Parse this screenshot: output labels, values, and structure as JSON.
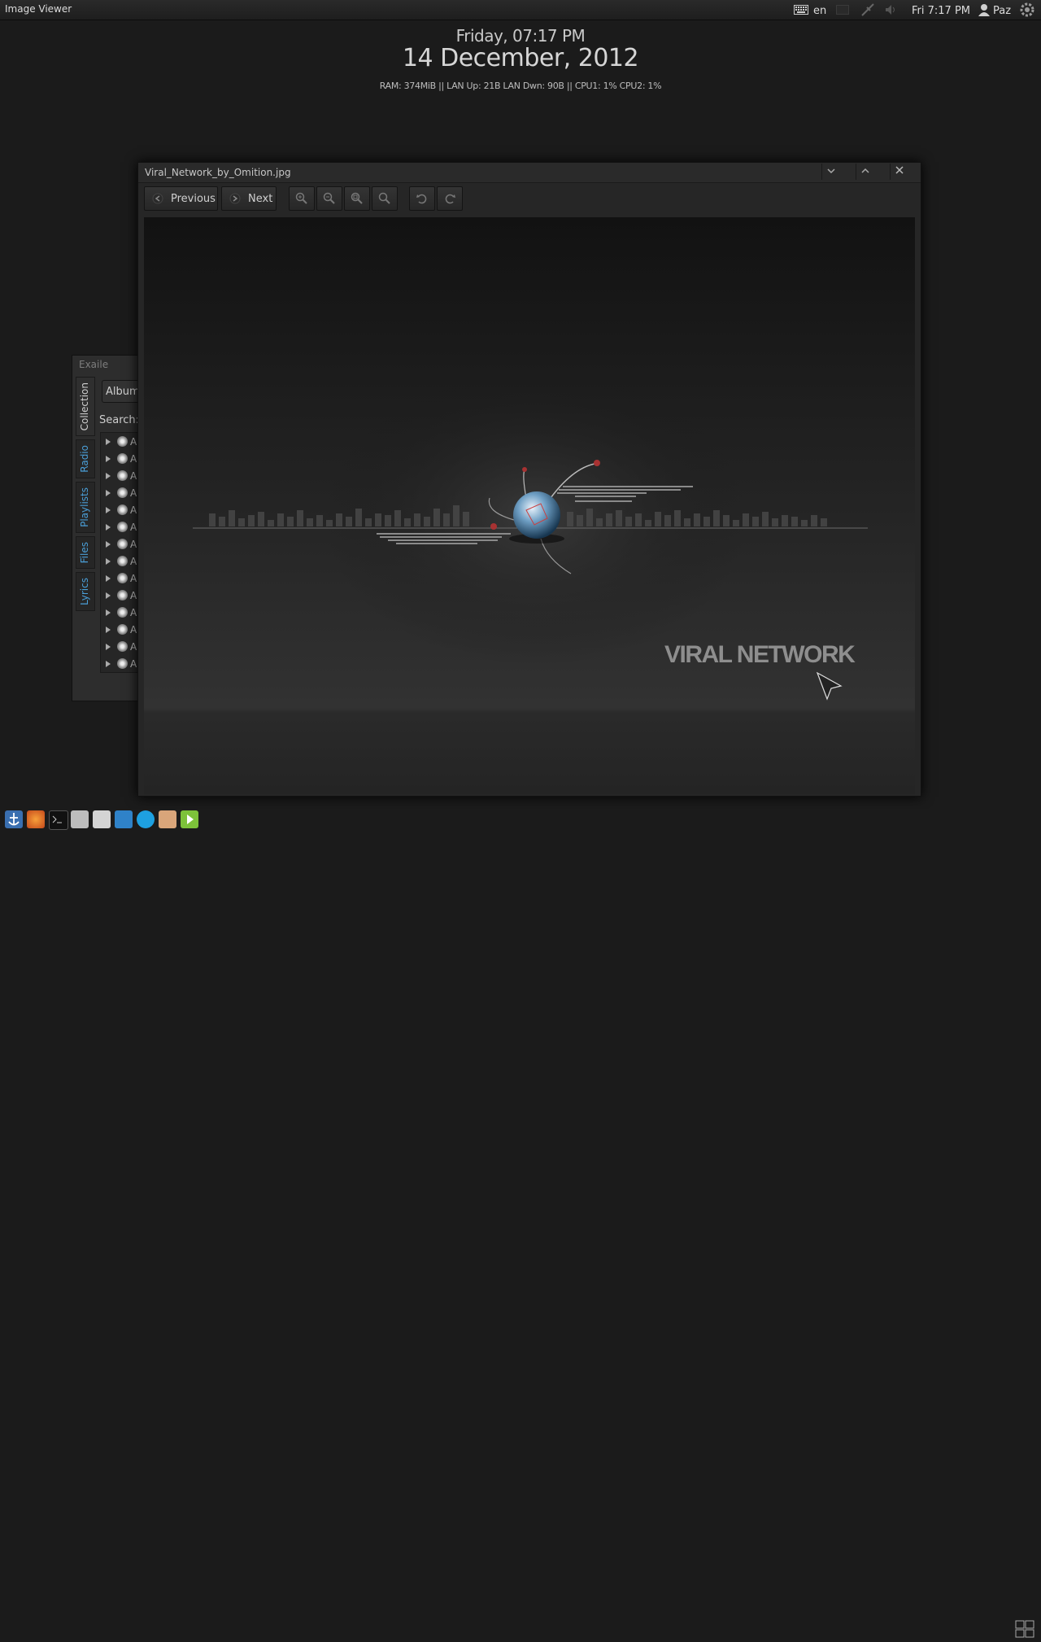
{
  "top_panel": {
    "active_app": "Image Viewer",
    "language": "en",
    "clock": "Fri  7:17 PM",
    "user": "Paz",
    "icons": [
      "keyboard-icon",
      "mail-icon",
      "network-icon",
      "volume-icon",
      "user-icon",
      "gear-icon"
    ]
  },
  "conky": {
    "day_time": "Friday, 07:17 PM",
    "date": "14 December, 2012",
    "stats": "RAM: 374MiB || LAN Up: 21B LAN Dwn: 90B || CPU1: 1% CPU2: 1%"
  },
  "exaile": {
    "title": "Exaile",
    "tabs": [
      "Collection",
      "Radio",
      "Playlists",
      "Files",
      "Lyrics"
    ],
    "album_button": "Album",
    "search_label": "Search:",
    "rows": [
      "A",
      "A",
      "A",
      "A",
      "A",
      "A",
      "A",
      "A",
      "A",
      "A",
      "A",
      "A",
      "A",
      "A"
    ]
  },
  "viewer": {
    "title": "Viral_Network_by_Omition.jpg",
    "previous_label": "Previous",
    "next_label": "Next",
    "image_text": "VIRAL NETWORK",
    "window_buttons": [
      "minimize-icon",
      "maximize-icon",
      "close-icon"
    ],
    "tool_icons": [
      "zoom-in-icon",
      "zoom-out-icon",
      "zoom-fit-icon",
      "zoom-normal-icon",
      "rotate-left-icon",
      "rotate-right-icon"
    ]
  },
  "dock": {
    "icons": [
      "anchor-icon",
      "firefox-icon",
      "terminal-icon",
      "mixer-icon",
      "disk-icon",
      "sync-icon",
      "skype-icon",
      "eye-icon",
      "media-player-icon",
      "workspace-switcher-icon"
    ]
  }
}
